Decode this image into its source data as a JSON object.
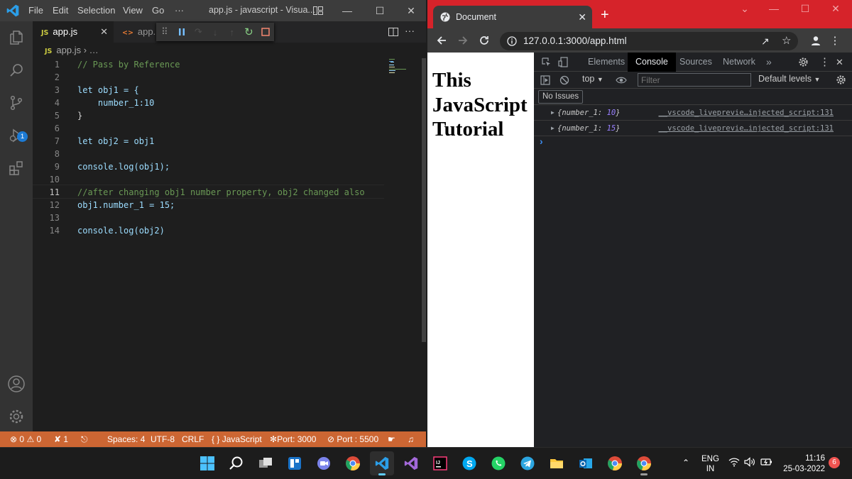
{
  "vscode": {
    "menu": [
      "File",
      "Edit",
      "Selection",
      "View",
      "Go",
      "···"
    ],
    "window_title": "app.js - javascript - Visua...",
    "tabs": [
      {
        "badge": "JS",
        "label": "app.js"
      },
      {
        "badge": "<>",
        "label": "app.h"
      }
    ],
    "breadcrumb": {
      "badge": "JS",
      "file": "app.js",
      "rest": "…"
    },
    "activity_badge": "1",
    "code_lines": [
      {
        "n": "1",
        "t": "// Pass by Reference"
      },
      {
        "n": "2",
        "t": ""
      },
      {
        "n": "3",
        "t": "let obj1 = {"
      },
      {
        "n": "4",
        "t": "    number_1:10"
      },
      {
        "n": "5",
        "t": "}"
      },
      {
        "n": "6",
        "t": ""
      },
      {
        "n": "7",
        "t": "let obj2 = obj1"
      },
      {
        "n": "8",
        "t": ""
      },
      {
        "n": "9",
        "t": "console.log(obj1);"
      },
      {
        "n": "10",
        "t": ""
      },
      {
        "n": "11",
        "t": "//after changing obj1 number property, obj2 changed also"
      },
      {
        "n": "12",
        "t": "obj1.number_1 = 15;"
      },
      {
        "n": "13",
        "t": ""
      },
      {
        "n": "14",
        "t": "console.log(obj2)"
      }
    ],
    "status": {
      "errors": "0",
      "warnings": "0",
      "tools": "1",
      "spaces": "Spaces: 4",
      "encoding": "UTF-8",
      "eol": "CRLF",
      "language": "JavaScript",
      "port1": "Port: 3000",
      "port2": "Port : 5500"
    }
  },
  "chrome": {
    "tab_title": "Document",
    "url": "127.0.0.1:3000/app.html",
    "page_heading": "This JavaScript Tutorial",
    "devtools": {
      "tabs": [
        "Elements",
        "Console",
        "Sources",
        "Network"
      ],
      "active_tab": "Console",
      "context": "top",
      "filter_placeholder": "Filter",
      "levels": "Default levels",
      "issues": "No Issues",
      "logs": [
        {
          "key": "number_1",
          "value": "10",
          "source": "__vscode_liveprevie…injected_script:131"
        },
        {
          "key": "number_1",
          "value": "15",
          "source": "__vscode_liveprevie…injected_script:131"
        }
      ]
    }
  },
  "taskbar": {
    "lang1": "ENG",
    "lang2": "IN",
    "time": "11:16",
    "date": "25-03-2022",
    "notifications": "6"
  },
  "colors": {
    "status_bar": "#cc6633",
    "chrome_tabbar": "#d6232a",
    "accent": "#007acc"
  }
}
